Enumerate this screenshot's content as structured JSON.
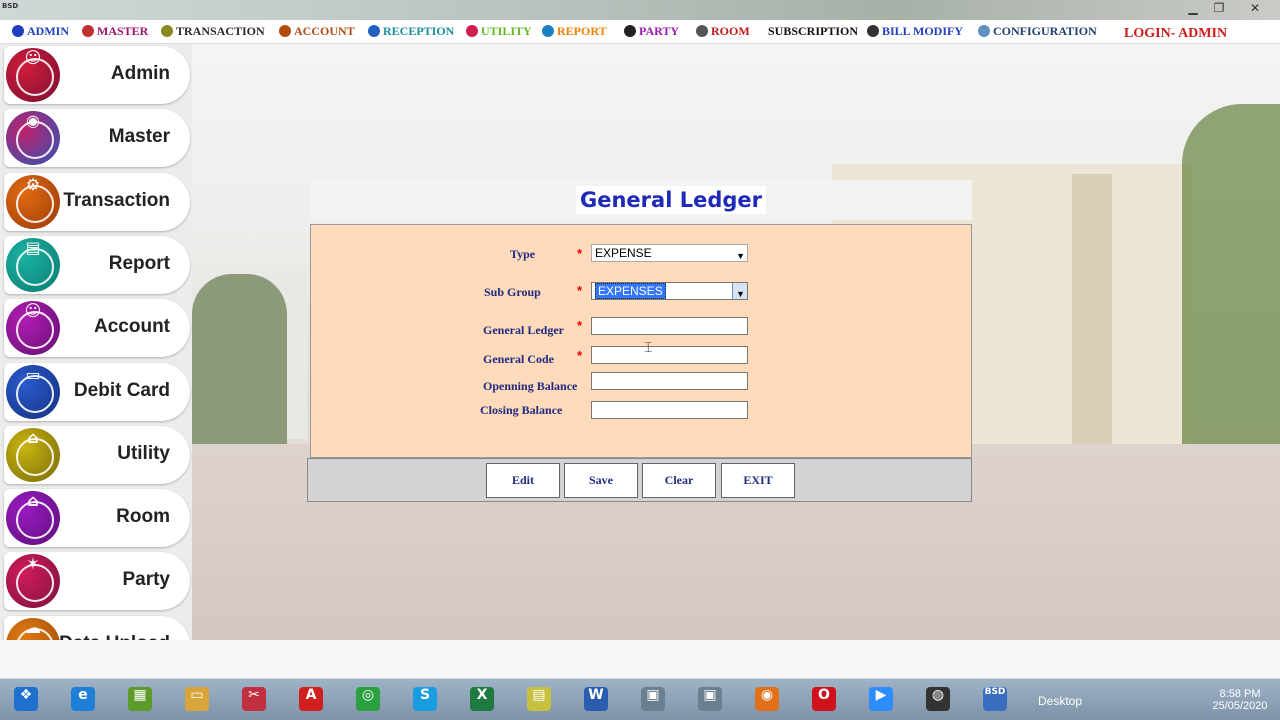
{
  "titlebar": {
    "app_icon_text": "BSD",
    "min": "▁",
    "max": "❐",
    "close": "✕"
  },
  "menubar": {
    "items": [
      {
        "label": "ADMIN",
        "color": "#1f3fbf",
        "icon_color": "#1f3fbf"
      },
      {
        "label": "MASTER",
        "color": "#a0146e",
        "icon_color": "#c03030"
      },
      {
        "label": "TRANSACTION",
        "color": "#2a2a2a",
        "icon_color": "#8a8a20"
      },
      {
        "label": "ACCOUNT",
        "color": "#b34a10",
        "icon_color": "#b34a10"
      },
      {
        "label": "RECEPTION",
        "color": "#1a8fa0",
        "icon_color": "#2060c0"
      },
      {
        "label": "UTILITY",
        "color": "#5fb81f",
        "icon_color": "#d02050"
      },
      {
        "label": "REPORT",
        "color": "#f08000",
        "icon_color": "#1a80c0"
      },
      {
        "label": "PARTY",
        "color": "#9a1ab0",
        "icon_color": "#222222"
      },
      {
        "label": "ROOM",
        "color": "#c01818",
        "icon_color": "#555555"
      },
      {
        "label": "SUBSCRIPTION",
        "color": "#111111",
        "icon_color": "transparent"
      },
      {
        "label": "BILL MODIFY",
        "color": "#1f3fbf",
        "icon_color": "#333333"
      },
      {
        "label": "CONFIGURATION",
        "color": "#1f3f6f",
        "icon_color": "#6090c0"
      }
    ],
    "login": "LOGIN- ADMIN"
  },
  "sidebar": {
    "items": [
      {
        "label": "Admin",
        "icon": "admin-icon",
        "glyph": "☺",
        "color": "#d01c3c",
        "color2": "#7a1030"
      },
      {
        "label": "Master",
        "icon": "master-icon",
        "glyph": "◉",
        "color": "#c0206a",
        "color2": "#2b56b8"
      },
      {
        "label": "Transaction",
        "icon": "transaction-icon",
        "glyph": "⚙",
        "color": "#e06a12",
        "color2": "#9a3a08"
      },
      {
        "label": "Report",
        "icon": "report-icon",
        "glyph": "▤",
        "color": "#19b3a3",
        "color2": "#0d7a70"
      },
      {
        "label": "Account",
        "icon": "account-icon",
        "glyph": "☺",
        "color": "#b41cb4",
        "color2": "#601070"
      },
      {
        "label": "Debit Card",
        "icon": "debit-card-icon",
        "glyph": "▭",
        "color": "#2b5bd0",
        "color2": "#14307a"
      },
      {
        "label": "Utility",
        "icon": "utility-icon",
        "glyph": "⌂",
        "color": "#c8b410",
        "color2": "#7a6a08"
      },
      {
        "label": "Room",
        "icon": "room-icon",
        "glyph": "⌂",
        "color": "#9a1ac0",
        "color2": "#5a107a"
      },
      {
        "label": "Party",
        "icon": "party-icon",
        "glyph": "✶",
        "color": "#d01c5a",
        "color2": "#7a1040"
      },
      {
        "label": "Data Upload",
        "icon": "data-upload-icon",
        "glyph": "☁",
        "color": "#e07a12",
        "color2": "#9a4a08"
      }
    ]
  },
  "form": {
    "title": "General Ledger",
    "type_label": "Type",
    "type_value": "EXPENSE",
    "subgroup_label": "Sub Group",
    "subgroup_value": "EXPENSES",
    "general_ledger_label": "General Ledger",
    "general_ledger_value": "",
    "general_code_label": "General Code",
    "general_code_value": "",
    "opening_balance_label": "Openning Balance",
    "opening_balance_value": "",
    "closing_balance_label": "Closing Balance",
    "closing_balance_value": "",
    "required_mark": "*",
    "buttons": {
      "edit": "Edit",
      "save": "Save",
      "clear": "Clear",
      "exit": "EXIT"
    }
  },
  "taskbar": {
    "items": [
      {
        "name": "start-orb",
        "glyph": "❖",
        "color": "#1f6fcf"
      },
      {
        "name": "internet-explorer",
        "glyph": "e",
        "color": "#1f7fd6"
      },
      {
        "name": "calculator",
        "glyph": "▦",
        "color": "#5c9a2a"
      },
      {
        "name": "file-explorer",
        "glyph": "▭",
        "color": "#d9a53a"
      },
      {
        "name": "snipping-tool",
        "glyph": "✂",
        "color": "#c03040"
      },
      {
        "name": "acrobat",
        "glyph": "A",
        "color": "#cf1f1f"
      },
      {
        "name": "chrome",
        "glyph": "◎",
        "color": "#2aa040"
      },
      {
        "name": "skype",
        "glyph": "S",
        "color": "#1a9de0"
      },
      {
        "name": "excel",
        "glyph": "X",
        "color": "#1e7a3e"
      },
      {
        "name": "notes",
        "glyph": "▤",
        "color": "#c8c040"
      },
      {
        "name": "word",
        "glyph": "W",
        "color": "#2a5db0"
      },
      {
        "name": "app-window-1",
        "glyph": "▣",
        "color": "#6a7f90"
      },
      {
        "name": "app-window-2",
        "glyph": "▣",
        "color": "#6a7f90"
      },
      {
        "name": "firefox",
        "glyph": "◉",
        "color": "#e0701a"
      },
      {
        "name": "opera",
        "glyph": "O",
        "color": "#d0101a"
      },
      {
        "name": "zoom",
        "glyph": "▶",
        "color": "#2d8cff"
      },
      {
        "name": "obs",
        "glyph": "◍",
        "color": "#333333"
      },
      {
        "name": "bsd-app",
        "glyph": "BSD",
        "color": "#3a6fc0"
      }
    ],
    "desktop_label": "Desktop",
    "time": "8:58 PM",
    "date": "25/05/2020"
  }
}
